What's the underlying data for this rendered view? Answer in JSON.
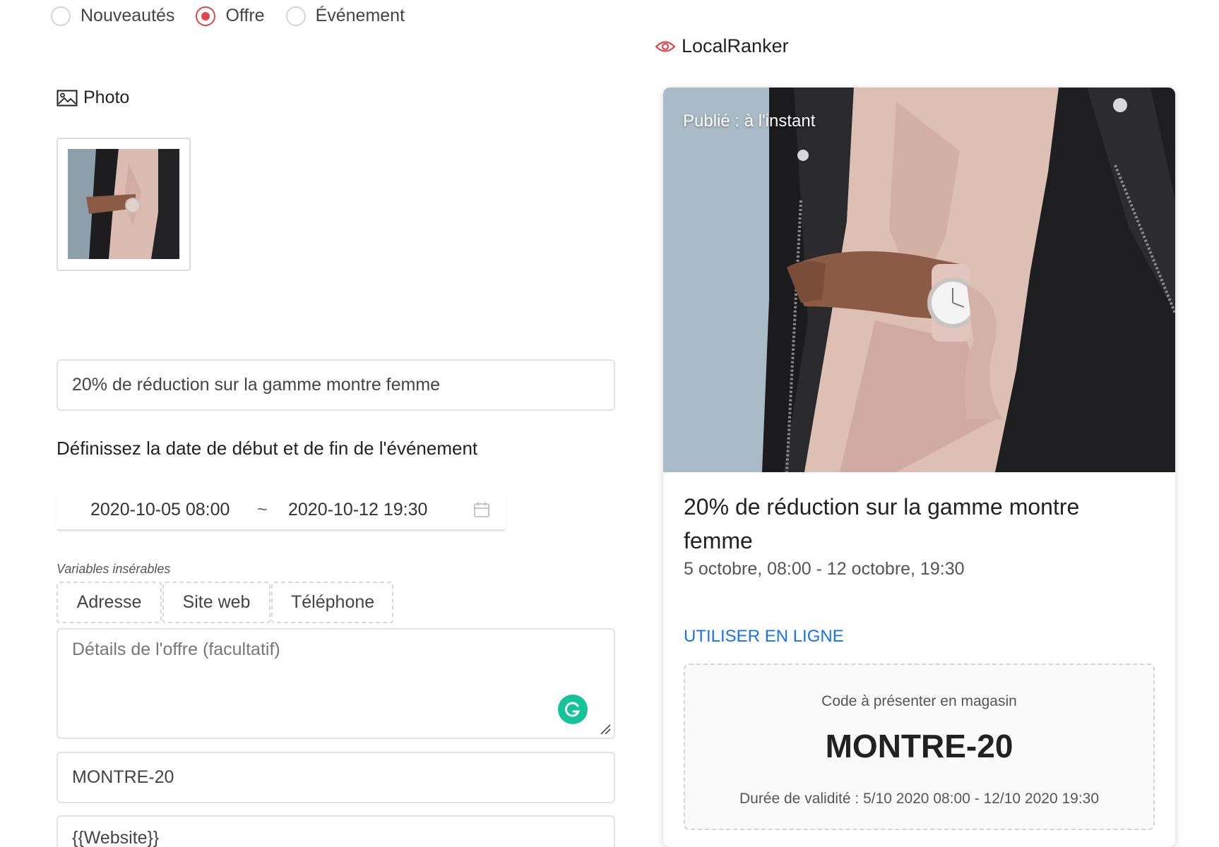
{
  "post_type": {
    "options": [
      {
        "label": "Nouveautés",
        "selected": false
      },
      {
        "label": "Offre",
        "selected": true
      },
      {
        "label": "Événement",
        "selected": false
      }
    ]
  },
  "photo": {
    "title": "Photo",
    "icon": "image-icon"
  },
  "form": {
    "title_value": "20% de réduction sur la gamme montre femme",
    "date_label": "Définissez la date de début et de fin de l'événement",
    "date_start": "2020-10-05 08:00",
    "date_separator": "~",
    "date_end": "2020-10-12 19:30",
    "variables_label": "Variables insérables",
    "variables": [
      "Adresse",
      "Site web",
      "Téléphone"
    ],
    "details_placeholder": "Détails de l'offre (facultatif)",
    "coupon_code_value": "MONTRE-20",
    "website_value": "{{Website}}"
  },
  "preview": {
    "header": "LocalRanker",
    "published": "Publié : à l'instant",
    "title": "20% de réduction sur la gamme montre femme",
    "dates": "5 octobre, 08:00 - 12 octobre, 19:30",
    "link": "UTILISER EN LIGNE",
    "coupon_label": "Code à présenter en magasin",
    "coupon_code": "MONTRE-20",
    "validity": "Durée de validité : 5/10 2020 08:00 - 12/10 2020 19:30"
  },
  "colors": {
    "accent_red": "#e0474c",
    "link_blue": "#1a73e8",
    "grammarly_green": "#15c39a"
  }
}
